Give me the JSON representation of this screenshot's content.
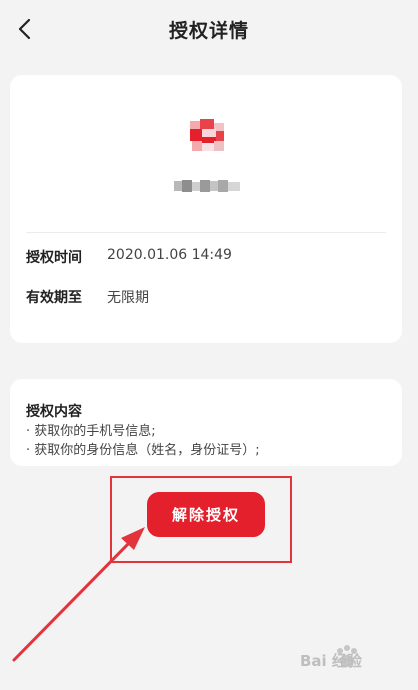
{
  "header": {
    "title": "授权详情",
    "back_icon": "chevron-left-icon"
  },
  "app": {
    "logo_icon": "app-logo-icon",
    "accent_color": "#e3202b"
  },
  "details": {
    "rows": [
      {
        "label": "授权时间",
        "value": "2020.01.06 14:49"
      },
      {
        "label": "有效期至",
        "value": "无限期"
      }
    ]
  },
  "content": {
    "title": "授权内容",
    "items": [
      "· 获取你的手机号信息;",
      "· 获取你的身份信息（姓名，身份证号）;"
    ]
  },
  "actions": {
    "revoke_label": "解除授权"
  },
  "watermark": {
    "text": "Bai 经验"
  }
}
